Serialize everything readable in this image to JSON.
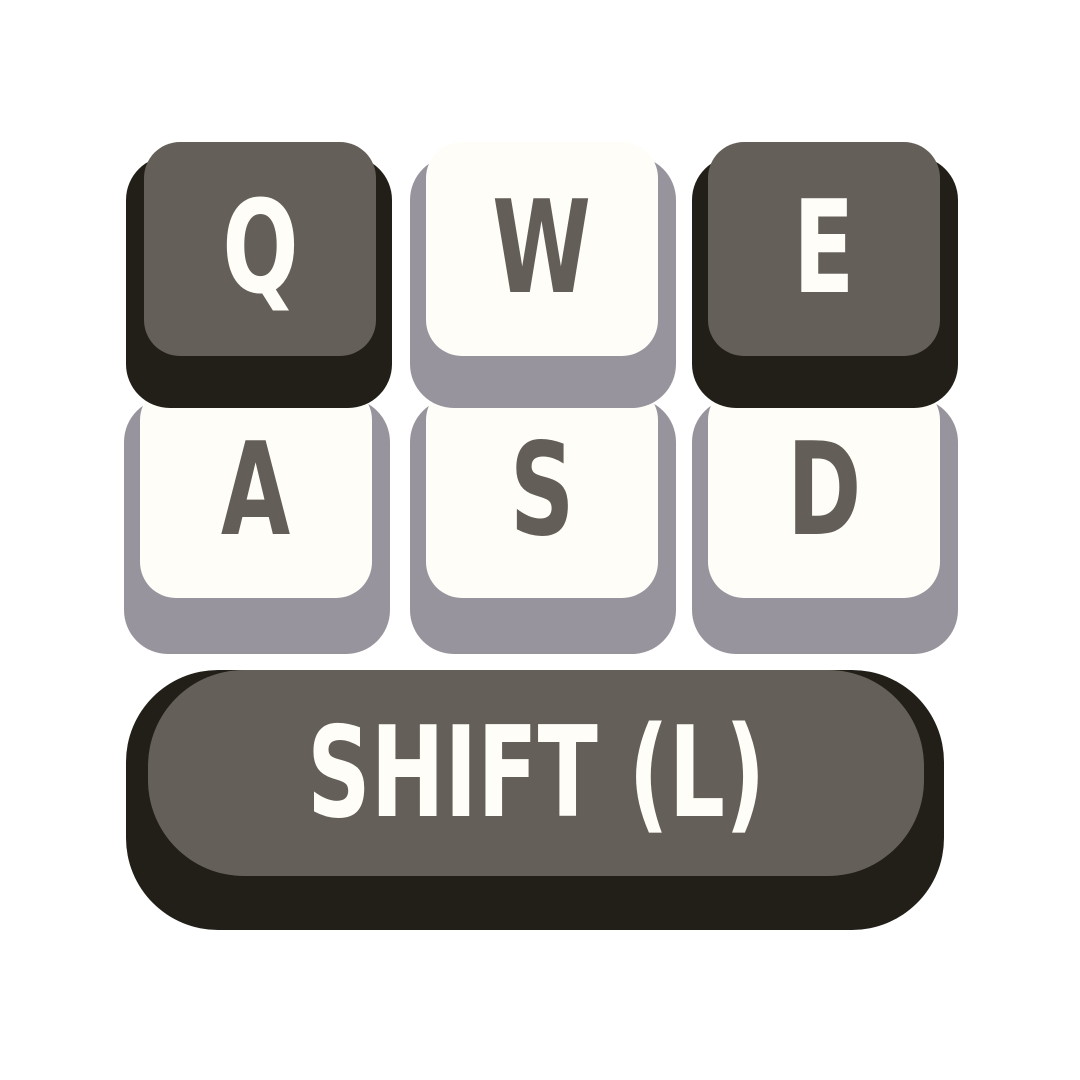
{
  "keyboard": {
    "row1": [
      {
        "label": "Q",
        "style": "dark"
      },
      {
        "label": "W",
        "style": "light"
      },
      {
        "label": "E",
        "style": "dark"
      }
    ],
    "row2": [
      {
        "label": "A",
        "style": "light"
      },
      {
        "label": "S",
        "style": "light"
      },
      {
        "label": "D",
        "style": "light"
      }
    ],
    "shift": {
      "label": "SHIFT (L)",
      "style": "dark"
    }
  },
  "colors": {
    "dark_cap": "#655f59",
    "dark_base": "#221f18",
    "light_cap": "#fefdf8",
    "light_base": "#98949d"
  }
}
